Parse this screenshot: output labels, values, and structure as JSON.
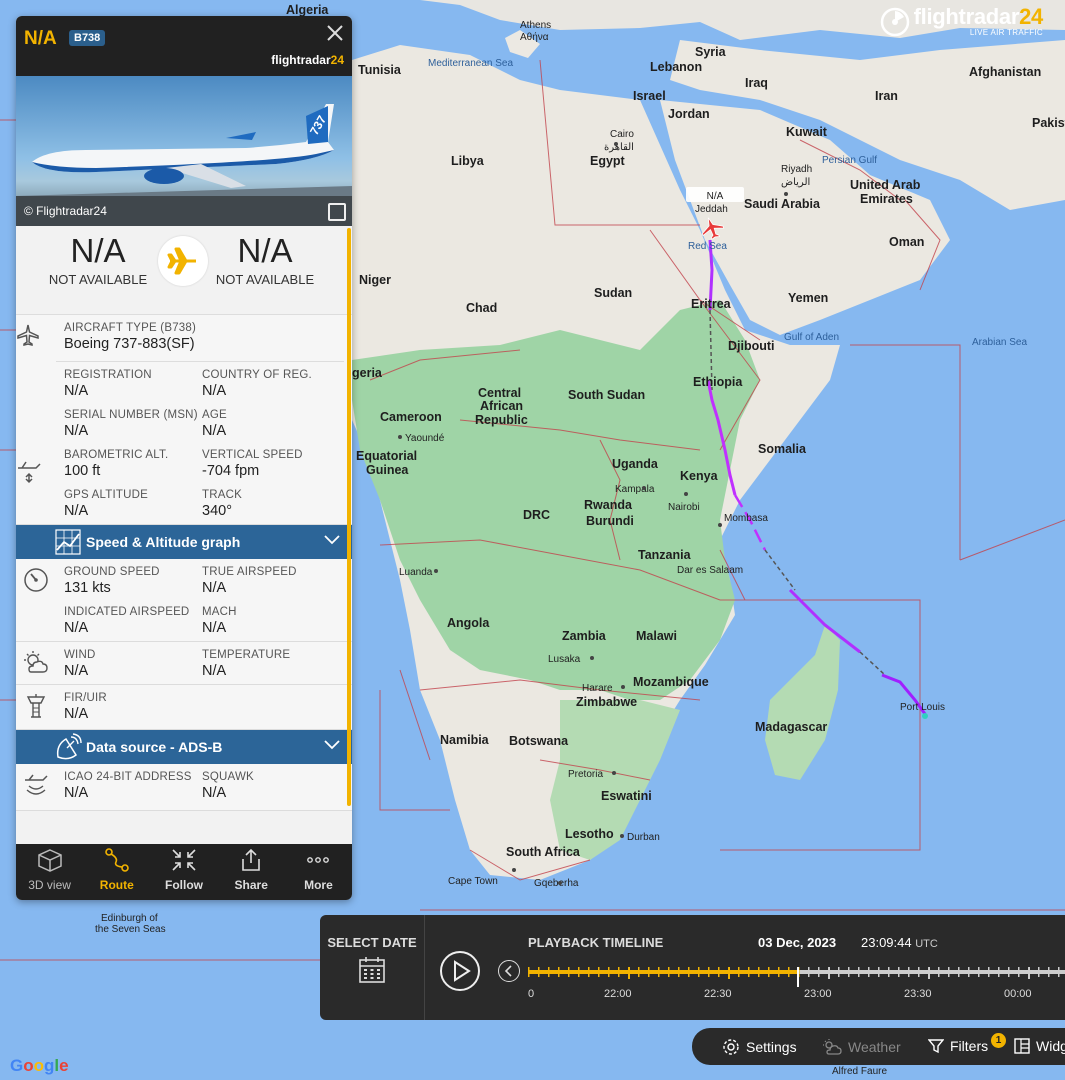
{
  "logo": {
    "main": "flightradar",
    "suffix": "24",
    "tagline": "LIVE AIR TRAFFIC"
  },
  "panel": {
    "callsign": "N/A",
    "type_code": "B738",
    "brand_main": "flightradar",
    "brand_suffix": "24",
    "photo_credit": "© Flightradar24",
    "origin": {
      "code": "N/A",
      "name": "NOT AVAILABLE"
    },
    "destination": {
      "code": "N/A",
      "name": "NOT AVAILABLE"
    },
    "aircraft_type_label": "AIRCRAFT TYPE (B738)",
    "aircraft_type_value": "Boeing 737-883(SF)",
    "registration": {
      "label": "REGISTRATION",
      "value": "N/A"
    },
    "country": {
      "label": "COUNTRY OF REG.",
      "value": "N/A"
    },
    "serial": {
      "label": "SERIAL NUMBER (MSN)",
      "value": "N/A"
    },
    "age": {
      "label": "AGE",
      "value": "N/A"
    },
    "baro_alt": {
      "label": "BAROMETRIC ALT.",
      "value": "100 ft"
    },
    "vert_speed": {
      "label": "VERTICAL SPEED",
      "value": "-704 fpm"
    },
    "gps_alt": {
      "label": "GPS ALTITUDE",
      "value": "N/A"
    },
    "track": {
      "label": "TRACK",
      "value": "340°"
    },
    "graph_bar": "Speed & Altitude graph",
    "ground_speed": {
      "label": "GROUND SPEED",
      "value": "131 kts"
    },
    "true_airspeed": {
      "label": "TRUE AIRSPEED",
      "value": "N/A"
    },
    "indicated_airspeed": {
      "label": "INDICATED AIRSPEED",
      "value": "N/A"
    },
    "mach": {
      "label": "MACH",
      "value": "N/A"
    },
    "wind": {
      "label": "WIND",
      "value": "N/A"
    },
    "temperature": {
      "label": "TEMPERATURE",
      "value": "N/A"
    },
    "fir": {
      "label": "FIR/UIR",
      "value": "N/A"
    },
    "data_source_bar": "Data source - ADS-B",
    "icao": {
      "label": "ICAO 24-BIT ADDRESS",
      "value": "N/A"
    },
    "squawk": {
      "label": "SQUAWK",
      "value": "N/A"
    },
    "nav": [
      "3D view",
      "Route",
      "Follow",
      "Share",
      "More"
    ]
  },
  "map": {
    "aircraft_label": "N/A",
    "countries": [
      "Algeria",
      "Tunisia",
      "Libya",
      "Egypt",
      "Syria",
      "Lebanon",
      "Israel",
      "Jordan",
      "Iraq",
      "Iran",
      "Afghanistan",
      "Pakista",
      "Kuwait",
      "Saudi Arabia",
      "United Arab",
      "Emirates",
      "Oman",
      "Yemen",
      "Niger",
      "Chad",
      "Sudan",
      "Eritrea",
      "Djibouti",
      "Ethiopia",
      "Somalia",
      "geria",
      "Cameroon",
      "Central",
      "African",
      "Republic",
      "South Sudan",
      "Equatorial",
      "Guinea",
      "Uganda",
      "Kenya",
      "Rwanda",
      "Burundi",
      "DRC",
      "Tanzania",
      "Angola",
      "Zambia",
      "Malawi",
      "Mozambique",
      "Zimbabwe",
      "Madagascar",
      "Namibia",
      "Botswana",
      "Eswatini",
      "Lesotho",
      "South Africa"
    ],
    "cities": [
      "Athens",
      "Αθήνα",
      "Cairo",
      "القاهرة",
      "Riyadh",
      "الرياض",
      "Jeddah",
      "Yaoundé",
      "Kampala",
      "Nairobi",
      "Mombasa",
      "Dar es Salaam",
      "Luanda",
      "Lusaka",
      "Harare",
      "Pretoria",
      "Durban",
      "Cape Town",
      "Gqeberha",
      "Port Louis",
      "Edinburgh of",
      "the Seven Seas",
      "Alfred Faure"
    ],
    "seas": [
      "Mediterranean Sea",
      "Persian Gulf",
      "Red Sea",
      "Gulf of Aden",
      "Arabian Sea"
    ]
  },
  "playback": {
    "select_date": "SELECT DATE",
    "title": "PLAYBACK TIMELINE",
    "date": "03 Dec, 2023",
    "time": "23:09:44",
    "tz": "UTC",
    "labels": [
      "0",
      "22:00",
      "22:30",
      "23:00",
      "23:30",
      "00:00"
    ],
    "progress": 0.5
  },
  "toolbar": {
    "settings": "Settings",
    "weather": "Weather",
    "filters": "Filters",
    "filters_count": "1",
    "widgets": "Widg"
  },
  "google": "Google"
}
